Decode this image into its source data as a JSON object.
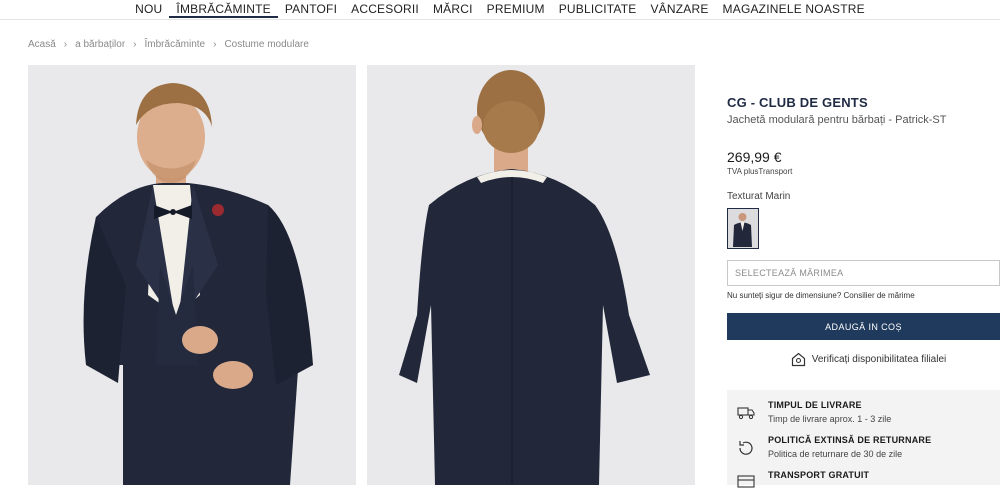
{
  "nav": {
    "items": [
      "NOU",
      "ÎMBRĂCĂMINTE",
      "PANTOFI",
      "ACCESORII",
      "MĂRCI",
      "PREMIUM",
      "PUBLICITATE",
      "VÂNZARE",
      "MAGAZINELE NOASTRE"
    ],
    "active_index": 1
  },
  "breadcrumb": [
    "Acasă",
    "a bărbaților",
    "Îmbrăcăminte",
    "Costume modulare"
  ],
  "product": {
    "brand": "CG - CLUB DE GENTS",
    "name": "Jachetă modulară pentru bărbați - Patrick-ST",
    "price": "269,99 €",
    "tax_prefix": "TVA plus",
    "tax_link": "Transport",
    "color_label": "Texturat Marin"
  },
  "size": {
    "placeholder": "SELECTEAZĂ MĂRIMEA",
    "hint_text": "Nu sunteți sigur de dimensiune? ",
    "hint_link": "Consilier de mărime"
  },
  "actions": {
    "add_to_cart": "ADAUGĂ IN COȘ",
    "store_check": "Verificați disponibilitatea filialei"
  },
  "perks": [
    {
      "icon": "truck-icon",
      "title": "TIMPUL DE LIVRARE",
      "desc": "Timp de livrare aprox. 1 - 3 zile"
    },
    {
      "icon": "return-icon",
      "title": "POLITICĂ EXTINSĂ DE RETURNARE",
      "desc": "Politica de returnare de 30 de zile"
    },
    {
      "icon": "package-icon",
      "title": "TRANSPORT GRATUIT",
      "desc": ""
    }
  ],
  "colors": {
    "accent": "#1f3a5c",
    "suit": "#22283a",
    "photo_bg": "#e9e9eb"
  }
}
